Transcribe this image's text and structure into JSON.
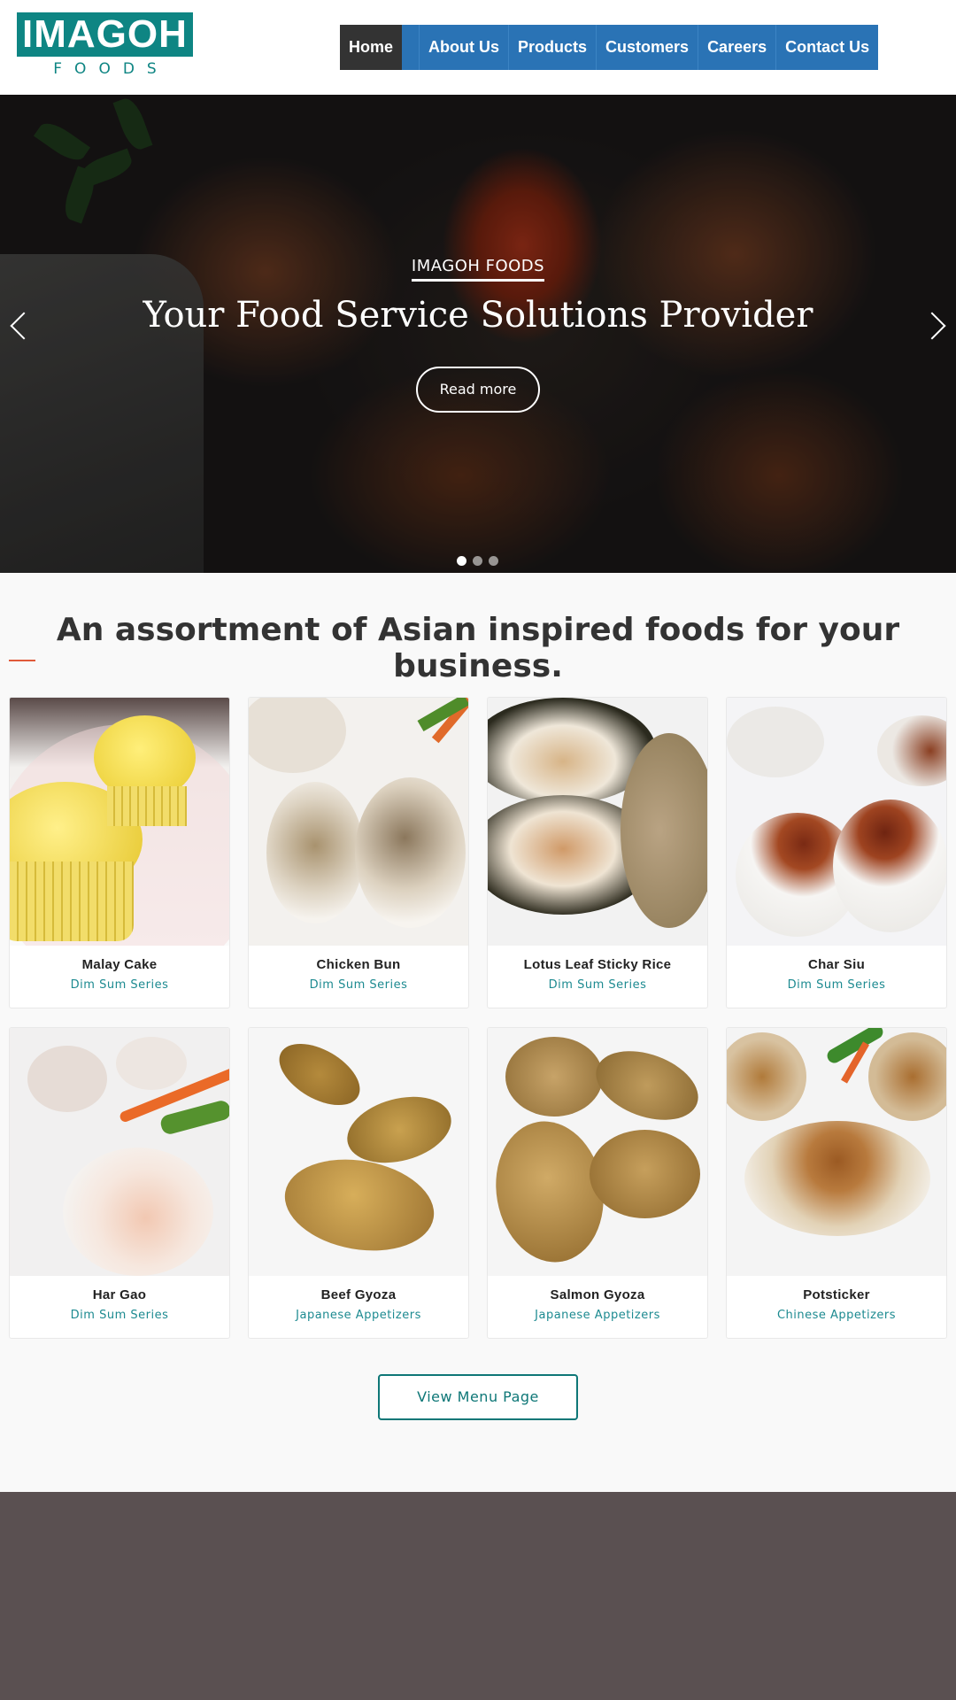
{
  "brand": {
    "logo_text": "IMAGOH",
    "logo_sub": "FOODS",
    "accent": "#0e8583"
  },
  "nav": {
    "items": [
      {
        "label": "Home",
        "active": true
      },
      {
        "label": "About Us",
        "active": false
      },
      {
        "label": "Products",
        "active": false
      },
      {
        "label": "Customers",
        "active": false
      },
      {
        "label": "Careers",
        "active": false
      },
      {
        "label": "Contact Us",
        "active": false
      }
    ],
    "bar_color": "#2a73b5"
  },
  "hero": {
    "kicker": "IMAGOH FOODS",
    "title": "Your Food Service Solutions Provider",
    "button": "Read more",
    "slides": 3,
    "active_slide": 1,
    "prev_icon": "chevron-left-icon",
    "next_icon": "chevron-right-icon"
  },
  "section": {
    "title": "An assortment of Asian inspired foods for your business."
  },
  "products": [
    {
      "name": "Malay Cake",
      "category": "Dim Sum Series"
    },
    {
      "name": "Chicken Bun",
      "category": "Dim Sum Series"
    },
    {
      "name": "Lotus Leaf Sticky Rice",
      "category": "Dim Sum Series"
    },
    {
      "name": "Char Siu",
      "category": "Dim Sum Series"
    },
    {
      "name": "Har Gao",
      "category": "Dim Sum Series"
    },
    {
      "name": "Beef Gyoza",
      "category": "Japanese Appetizers"
    },
    {
      "name": "Salmon Gyoza",
      "category": "Japanese Appetizers"
    },
    {
      "name": "Potsticker",
      "category": "Chinese Appetizers"
    }
  ],
  "cta": {
    "menu_button": "View Menu Page"
  }
}
